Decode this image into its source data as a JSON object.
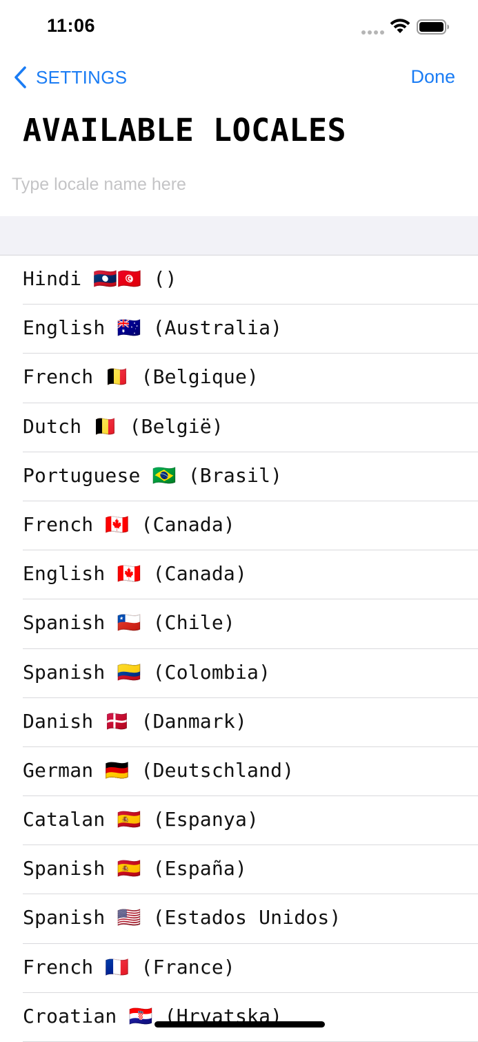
{
  "status_bar": {
    "time": "11:06"
  },
  "nav": {
    "back_label": "SETTINGS",
    "done_label": "Done"
  },
  "title": "AVAILABLE LOCALES",
  "search": {
    "placeholder": "Type locale name here",
    "value": ""
  },
  "colors": {
    "accent": "#1a7cf4",
    "section_header_bg": "#f2f2f7",
    "separator": "#d9d9dc",
    "placeholder": "#c4c4c6"
  },
  "icons": {
    "back": "chevron-left-icon",
    "wifi": "wifi-icon",
    "battery": "battery-icon",
    "signal": "signal-dots-icon"
  },
  "locales": [
    {
      "label": "Hindi 🇱🇦🇹🇳 ()"
    },
    {
      "label": "English 🇦🇺 (Australia)"
    },
    {
      "label": "French 🇧🇪 (Belgique)"
    },
    {
      "label": "Dutch 🇧🇪 (België)"
    },
    {
      "label": "Portuguese 🇧🇷 (Brasil)"
    },
    {
      "label": "French 🇨🇦 (Canada)"
    },
    {
      "label": "English 🇨🇦 (Canada)"
    },
    {
      "label": "Spanish 🇨🇱 (Chile)"
    },
    {
      "label": "Spanish 🇨🇴 (Colombia)"
    },
    {
      "label": "Danish 🇩🇰 (Danmark)"
    },
    {
      "label": "German 🇩🇪 (Deutschland)"
    },
    {
      "label": "Catalan 🇪🇸 (Espanya)"
    },
    {
      "label": "Spanish 🇪🇸 (España)"
    },
    {
      "label": "Spanish 🇺🇸 (Estados Unidos)"
    },
    {
      "label": "French 🇫🇷 (France)"
    },
    {
      "label": "Croatian 🇭🇷 (Hrvatska)"
    }
  ]
}
